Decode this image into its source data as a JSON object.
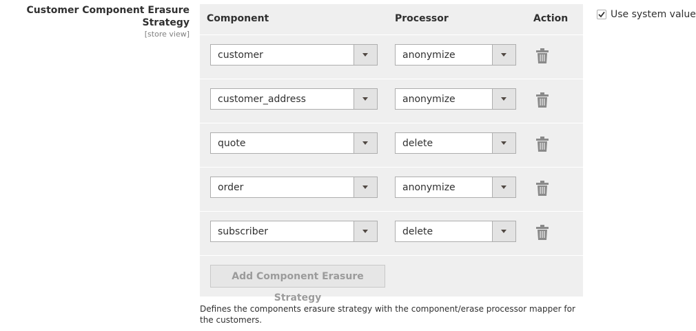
{
  "field": {
    "title": "Customer Component Erasure Strategy",
    "scope": "[store view]"
  },
  "grid": {
    "headers": {
      "component": "Component",
      "processor": "Processor",
      "action": "Action"
    },
    "rows": [
      {
        "component": "customer",
        "processor": "anonymize"
      },
      {
        "component": "customer_address",
        "processor": "anonymize"
      },
      {
        "component": "quote",
        "processor": "delete"
      },
      {
        "component": "order",
        "processor": "anonymize"
      },
      {
        "component": "subscriber",
        "processor": "delete"
      }
    ],
    "add_button": "Add Component Erasure Strategy"
  },
  "note": "Defines the components erasure strategy with the component/erase processor mapper for the customers.",
  "use_system_value": {
    "label": "Use system value",
    "checked": true
  },
  "icons": {
    "delete": "trash-icon",
    "dropdown": "chevron-down-icon",
    "checkbox": "checkmark-icon"
  },
  "colors": {
    "grid_background": "#efefef",
    "icon": "#8a8a8a"
  }
}
